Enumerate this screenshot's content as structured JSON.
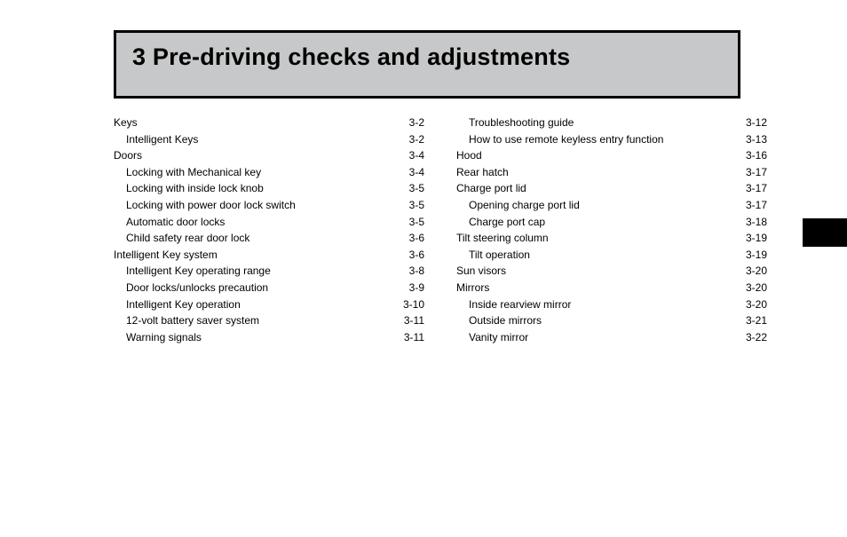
{
  "title": "3 Pre-driving checks and adjustments",
  "toc": {
    "left": [
      {
        "label": "Keys",
        "page": "3-2",
        "indent": 0
      },
      {
        "label": "Intelligent Keys",
        "page": "3-2",
        "indent": 1
      },
      {
        "label": "Doors",
        "page": "3-4",
        "indent": 0
      },
      {
        "label": "Locking with Mechanical key",
        "page": "3-4",
        "indent": 1
      },
      {
        "label": "Locking with inside lock knob",
        "page": "3-5",
        "indent": 1
      },
      {
        "label": "Locking with power door lock switch",
        "page": "3-5",
        "indent": 1
      },
      {
        "label": "Automatic door locks",
        "page": "3-5",
        "indent": 1
      },
      {
        "label": "Child safety rear door lock",
        "page": "3-6",
        "indent": 1
      },
      {
        "label": "Intelligent Key system",
        "page": "3-6",
        "indent": 0
      },
      {
        "label": "Intelligent Key operating range",
        "page": "3-8",
        "indent": 1
      },
      {
        "label": "Door locks/unlocks precaution",
        "page": "3-9",
        "indent": 1
      },
      {
        "label": "Intelligent Key operation",
        "page": "3-10",
        "indent": 1
      },
      {
        "label": "12-volt battery saver system",
        "page": "3-11",
        "indent": 1
      },
      {
        "label": "Warning signals",
        "page": "3-11",
        "indent": 1
      }
    ],
    "right": [
      {
        "label": "Troubleshooting guide",
        "page": "3-12",
        "indent": 1
      },
      {
        "label": "How to use remote keyless entry function",
        "page": "3-13",
        "indent": 1
      },
      {
        "label": "Hood",
        "page": "3-16",
        "indent": 0
      },
      {
        "label": "Rear hatch",
        "page": "3-17",
        "indent": 0
      },
      {
        "label": "Charge port lid",
        "page": "3-17",
        "indent": 0
      },
      {
        "label": "Opening charge port lid",
        "page": "3-17",
        "indent": 1
      },
      {
        "label": "Charge port cap",
        "page": "3-18",
        "indent": 1
      },
      {
        "label": "Tilt steering column",
        "page": "3-19",
        "indent": 0
      },
      {
        "label": "Tilt operation",
        "page": "3-19",
        "indent": 1
      },
      {
        "label": "Sun visors",
        "page": "3-20",
        "indent": 0
      },
      {
        "label": "Mirrors",
        "page": "3-20",
        "indent": 0
      },
      {
        "label": "Inside rearview mirror",
        "page": "3-20",
        "indent": 1
      },
      {
        "label": "Outside mirrors",
        "page": "3-21",
        "indent": 1
      },
      {
        "label": "Vanity mirror",
        "page": "3-22",
        "indent": 1
      }
    ]
  }
}
